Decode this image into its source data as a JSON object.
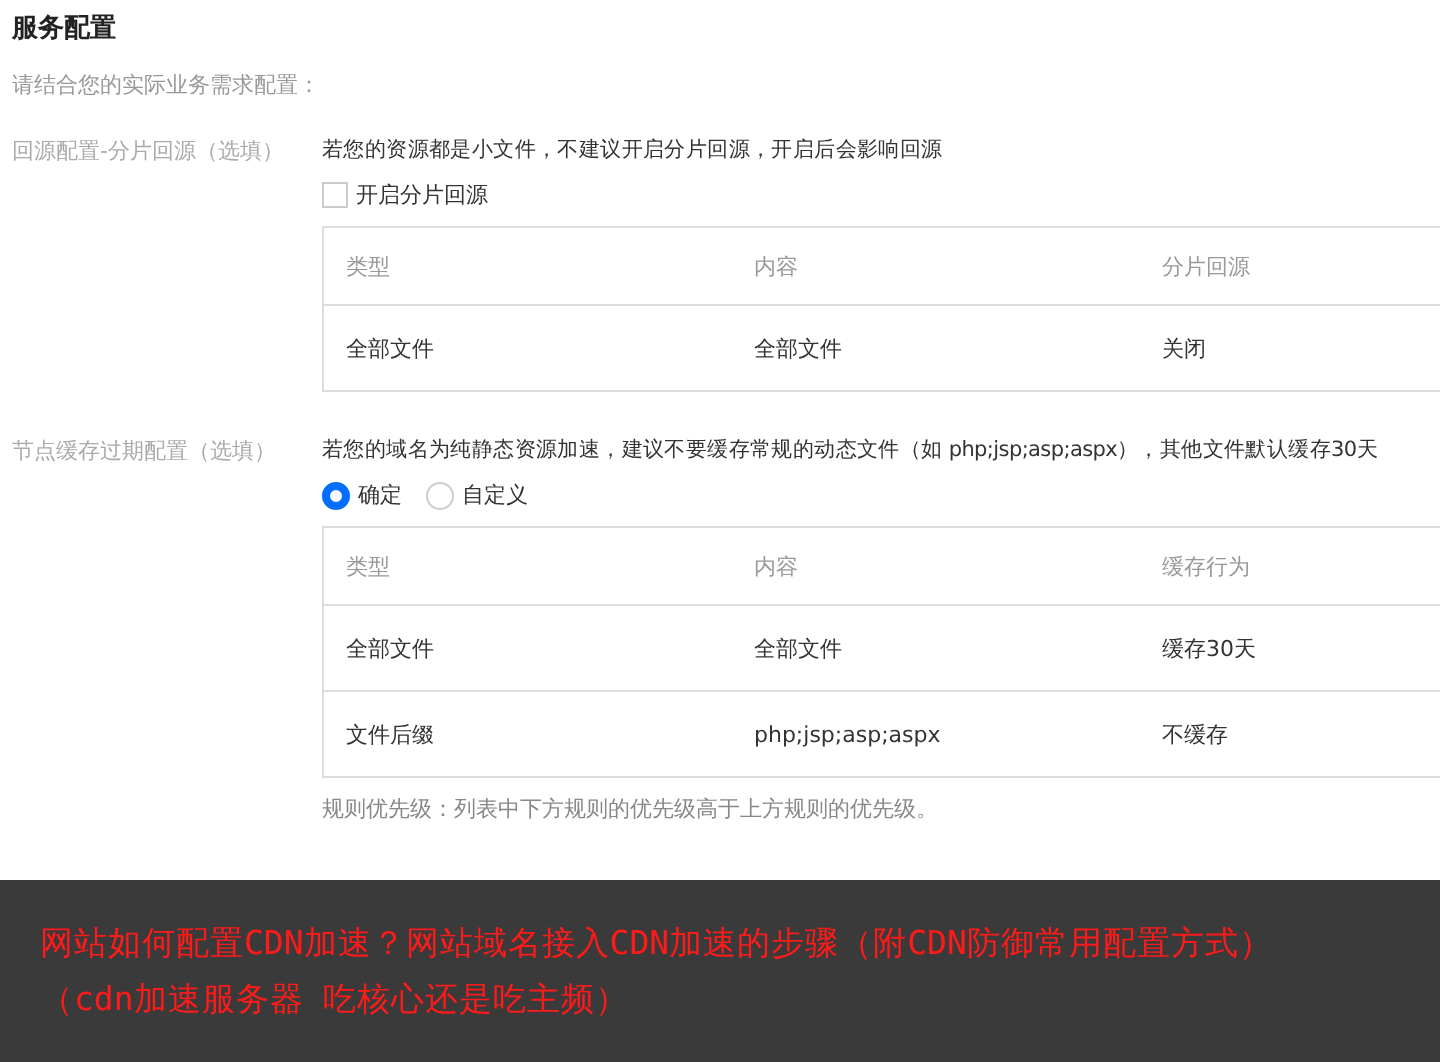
{
  "title": "服务配置",
  "subtitle": "请结合您的实际业务需求配置：",
  "sections": [
    {
      "label": "回源配置-分片回源（选填）",
      "hint": "若您的资源都是小文件，不建议开启分片回源，开启后会影响回源",
      "kind": "checkbox",
      "options": [
        {
          "label": "开启分片回源",
          "selected": false
        }
      ],
      "table": {
        "columns": [
          "类型",
          "内容",
          "分片回源"
        ],
        "rows": [
          [
            "全部文件",
            "全部文件",
            "关闭"
          ]
        ]
      }
    },
    {
      "label": "节点缓存过期配置（选填）",
      "hint": "若您的域名为纯静态资源加速，建议不要缓存常规的动态文件（如 php;jsp;asp;aspx），其他文件默认缓存30天",
      "kind": "radio",
      "options": [
        {
          "label": "确定",
          "selected": true
        },
        {
          "label": "自定义",
          "selected": false
        }
      ],
      "table": {
        "columns": [
          "类型",
          "内容",
          "缓存行为"
        ],
        "rows": [
          [
            "全部文件",
            "全部文件",
            "缓存30天"
          ],
          [
            "文件后缀",
            "php;jsp;asp;aspx",
            "不缓存"
          ]
        ]
      },
      "note": "规则优先级：列表中下方规则的优先级高于上方规则的优先级。"
    }
  ],
  "banner": {
    "title": "网站如何配置CDN加速？网站域名接入CDN加速的步骤（附CDN防御常用配置方式）（cdn加速服务器 吃核心还是吃主频）"
  }
}
